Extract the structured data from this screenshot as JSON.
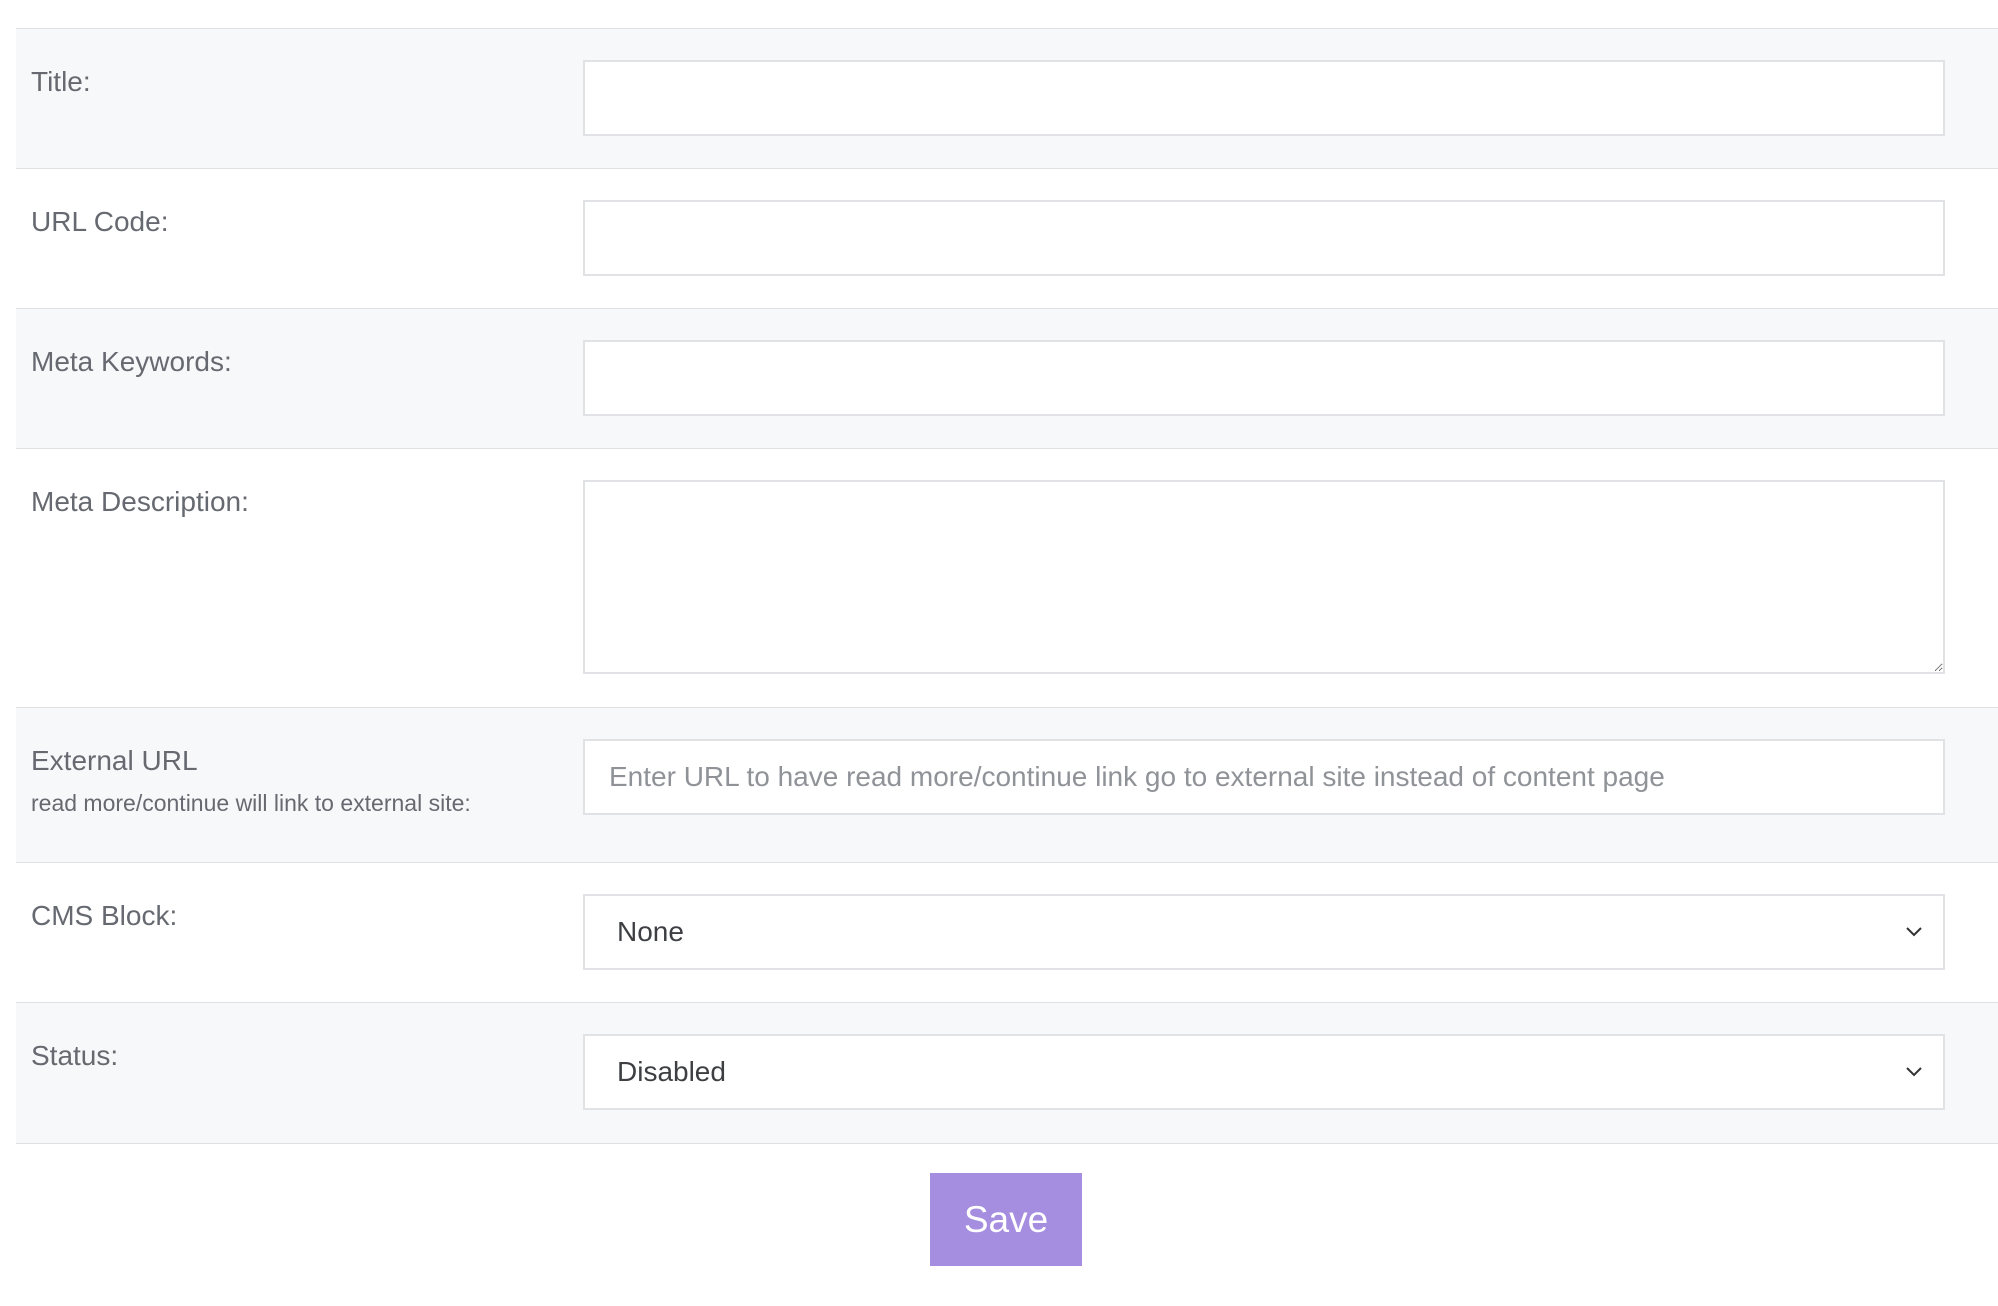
{
  "form": {
    "title": {
      "label": "Title:",
      "value": ""
    },
    "url_code": {
      "label": "URL Code:",
      "value": ""
    },
    "meta_keywords": {
      "label": "Meta Keywords:",
      "value": ""
    },
    "meta_description": {
      "label": "Meta Description:",
      "value": ""
    },
    "external_url": {
      "label": "External URL",
      "sublabel": "read more/continue will link to external site:",
      "value": "",
      "placeholder": "Enter URL to have read more/continue link go to external site instead of content page"
    },
    "cms_block": {
      "label": "CMS Block:",
      "selected": "None"
    },
    "status": {
      "label": "Status:",
      "selected": "Disabled"
    }
  },
  "actions": {
    "save_label": "Save"
  },
  "colors": {
    "row_shaded": "#f7f8fa",
    "border": "#dfe1e5",
    "label_text": "#666a70",
    "save_button": "#a58de0"
  },
  "icons": {
    "select_arrow": "chevron-down-icon"
  }
}
